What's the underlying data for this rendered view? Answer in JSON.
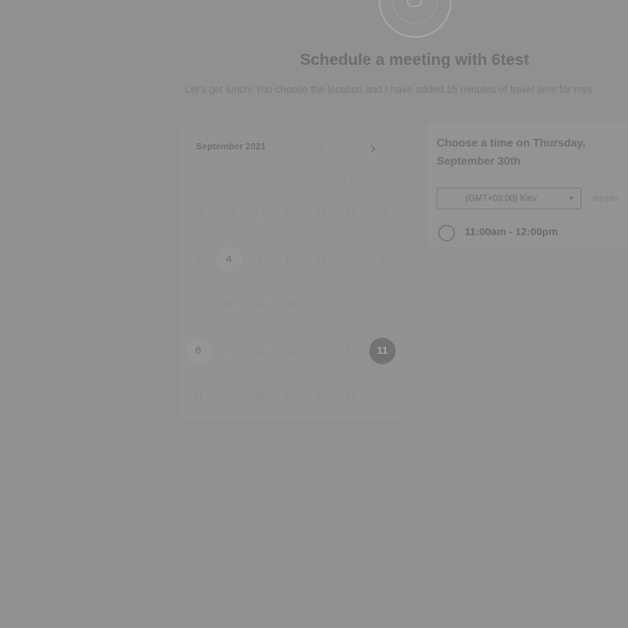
{
  "header": {
    "logo_icon": "calendar-logo-icon",
    "title": "Schedule a meeting with 6test",
    "subtitle": "Let’s get lunch! You choose the location and I have added 15 minutes of travel time for mys"
  },
  "calendar": {
    "month_label": "September 2021",
    "prev_icon": "chevron-left-icon",
    "next_icon": "chevron-right-icon",
    "weekdays": [
      "SUN",
      "MON",
      "TUE",
      "WED",
      "THU",
      "FRI",
      "SAT"
    ],
    "days": [
      {
        "label": "29",
        "row": 0,
        "col": 0,
        "state": "faded"
      },
      {
        "label": "30",
        "row": 0,
        "col": 1,
        "state": "faded"
      },
      {
        "label": "19",
        "row": 0,
        "col": 2,
        "state": "faded"
      },
      {
        "label": "27",
        "row": 0,
        "col": 3,
        "state": "faded"
      },
      {
        "label": "28",
        "row": 0,
        "col": 4,
        "state": "faded"
      },
      {
        "label": "29",
        "row": 0,
        "col": 5,
        "state": "faded"
      },
      {
        "label": "26",
        "row": 0,
        "col": 6,
        "state": "faded"
      },
      {
        "label": "3",
        "row": 1,
        "col": 0,
        "state": "faded"
      },
      {
        "label": "4",
        "row": 1,
        "col": 1,
        "state": "available"
      },
      {
        "label": "5",
        "row": 1,
        "col": 2,
        "state": "faded"
      },
      {
        "label": "10",
        "row": 1,
        "col": 3,
        "state": "faded"
      },
      {
        "label": "11",
        "row": 1,
        "col": 4,
        "state": "faded"
      },
      {
        "label": "5",
        "row": 1,
        "col": 5,
        "state": "normal"
      },
      {
        "label": "6",
        "row": 1,
        "col": 6,
        "state": "faded"
      },
      {
        "label": "10",
        "row": 2,
        "col": 0,
        "state": "faded"
      },
      {
        "label": "11",
        "row": 2,
        "col": 1,
        "state": "faded"
      },
      {
        "label": "12",
        "row": 2,
        "col": 2,
        "state": "faded"
      },
      {
        "label": "16",
        "row": 2,
        "col": 3,
        "state": "faded"
      },
      {
        "label": "17",
        "row": 2,
        "col": 4,
        "state": "faded"
      },
      {
        "label": "12",
        "row": 2,
        "col": 5,
        "state": "normal"
      },
      {
        "label": "13",
        "row": 2,
        "col": 6,
        "state": "faded"
      },
      {
        "label": "6",
        "row": 3,
        "col": 0,
        "state": "available"
      },
      {
        "label": "7",
        "row": 3,
        "col": 1,
        "state": "faded"
      },
      {
        "label": "22",
        "row": 3,
        "col": 2,
        "state": "faded"
      },
      {
        "label": "23",
        "row": 3,
        "col": 3,
        "state": "faded"
      },
      {
        "label": "9",
        "row": 3,
        "col": 4,
        "state": "faded"
      },
      {
        "label": "10",
        "row": 3,
        "col": 5,
        "state": "faded"
      },
      {
        "label": "11",
        "row": 3,
        "col": 6,
        "state": "selected"
      },
      {
        "label": "11",
        "row": 4,
        "col": 0,
        "state": "faded"
      },
      {
        "label": "12",
        "row": 4,
        "col": 1,
        "state": "normal"
      },
      {
        "label": "28",
        "row": 4,
        "col": 2,
        "state": "faded"
      },
      {
        "label": "29",
        "row": 4,
        "col": 3,
        "state": "faded"
      },
      {
        "label": "30",
        "row": 4,
        "col": 4,
        "state": "faded"
      },
      {
        "label": "18",
        "row": 4,
        "col": 5,
        "state": "faded"
      },
      {
        "label": "19",
        "row": 4,
        "col": 6,
        "state": "normal"
      }
    ]
  },
  "time_panel": {
    "heading": "Choose a time on Thursday, September 30th",
    "timezone_value": "(GMT+03:00) Kiev",
    "ampm_label": "am/pm",
    "slots": [
      "11:00am - 12:00pm"
    ]
  }
}
